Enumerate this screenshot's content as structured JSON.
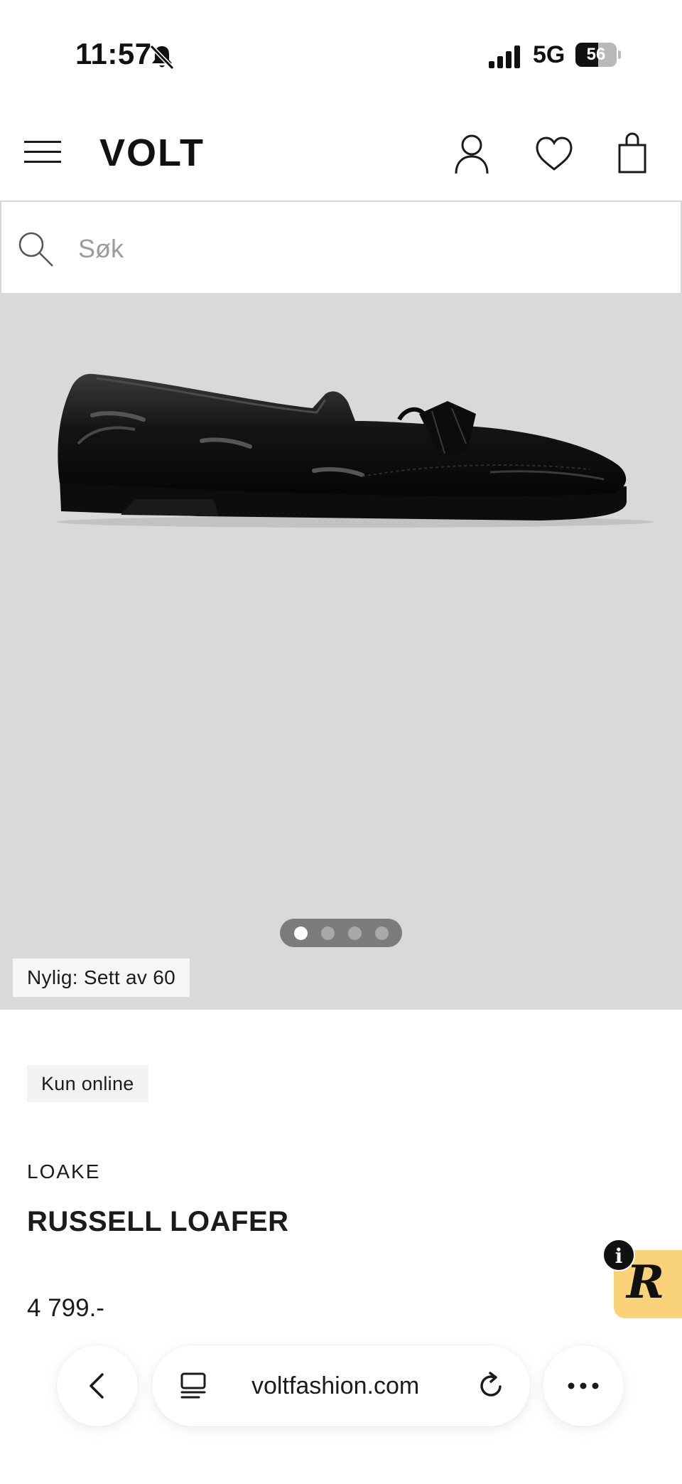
{
  "status_bar": {
    "time": "11:57",
    "network": "5G",
    "battery_level": "56",
    "battery_fraction": 0.56
  },
  "header": {
    "logo": "VOLT",
    "icons": [
      "menu-icon",
      "account-icon",
      "wishlist-icon",
      "cart-icon"
    ]
  },
  "search": {
    "placeholder": "Søk"
  },
  "gallery": {
    "image_count": 4,
    "active_index": 0,
    "recent_views_label": "Nylig: Sett av 60"
  },
  "product": {
    "tag": "Kun online",
    "brand": "LOAKE",
    "name": "RUSSELL LOAFER",
    "price": "4 799.-"
  },
  "widget": {
    "letter": "R",
    "info": "i",
    "color": "#f9d27a"
  },
  "browser": {
    "url": "voltfashion.com"
  }
}
